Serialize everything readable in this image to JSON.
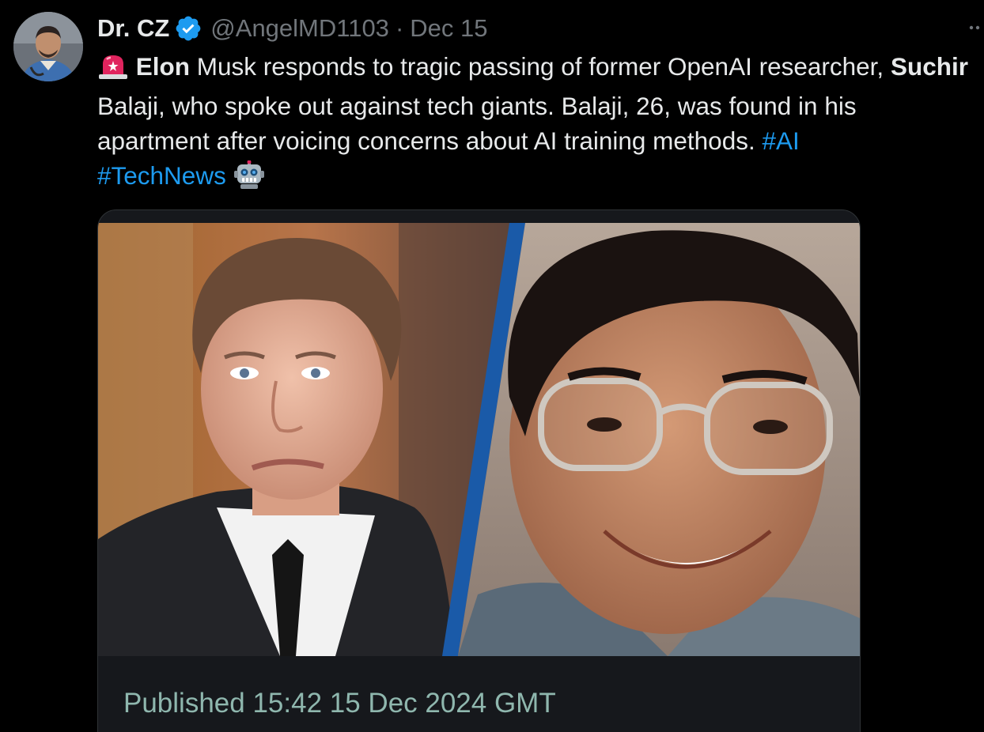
{
  "author": {
    "name": "Dr. CZ",
    "handle": "@AngelMD1103",
    "separator": "·",
    "date": "Dec 15",
    "verified": true
  },
  "tweet": {
    "emoji_start": "🚨",
    "seg1_bold": "Elon",
    "seg2": " Musk responds to tragic passing of former OpenAI researcher, ",
    "seg3_bold": "Suchir",
    "seg4": " Balaji, who spoke out against tech giants. Balaji, 26, was found in his apartment after voicing concerns about AI training methods. ",
    "hashtag1": "#AI",
    "hashtag2": "#TechNews",
    "emoji_end": "🤖"
  },
  "card": {
    "published": "Published 15:42 15 Dec 2024 GMT",
    "image_description_left": "portrait-man-suit",
    "image_description_right": "portrait-young-man-glasses"
  },
  "colors": {
    "background": "#000000",
    "text": "#e7e9ea",
    "muted": "#71767b",
    "link": "#1d9bf0",
    "verified": "#1d9bf0",
    "card_footer_text": "#8fb7ae"
  }
}
